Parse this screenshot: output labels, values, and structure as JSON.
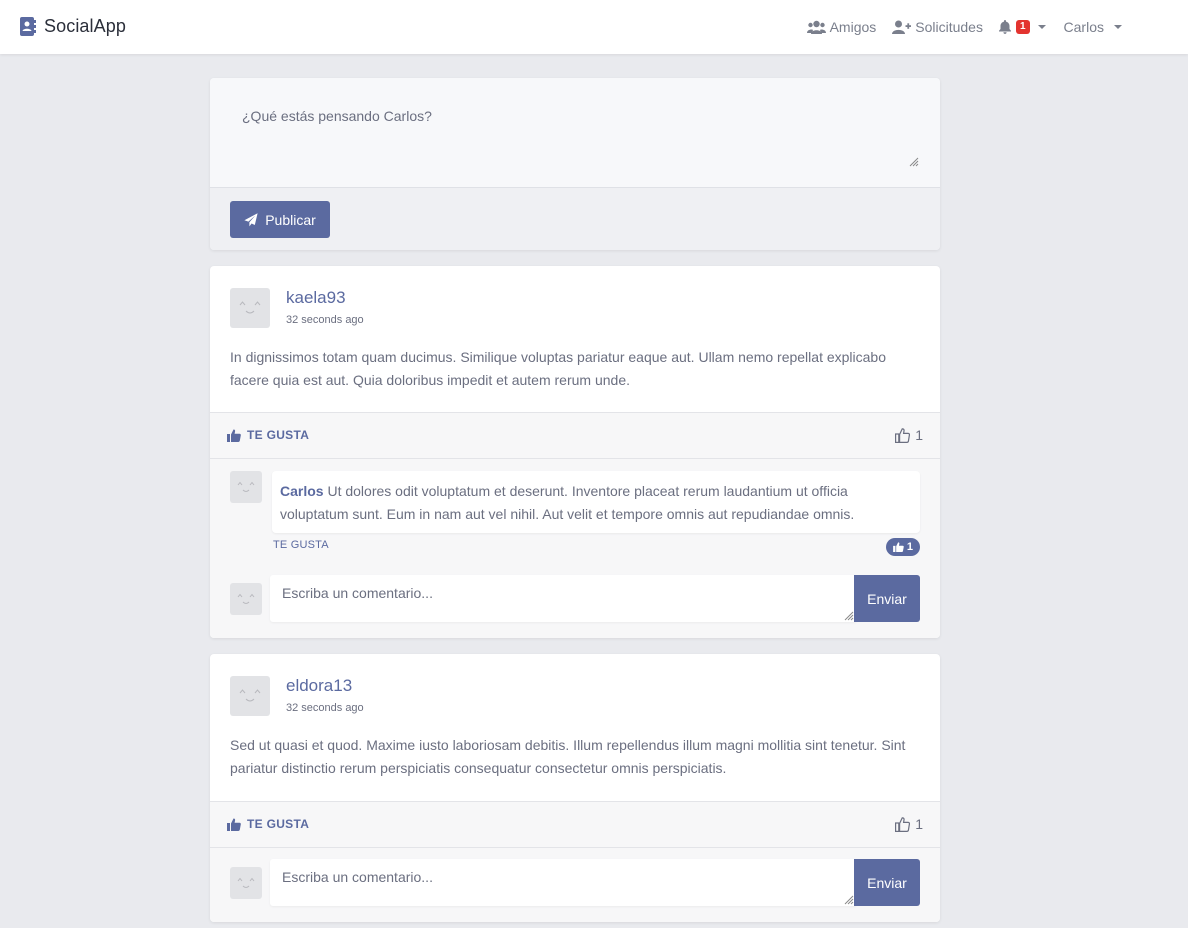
{
  "navbar": {
    "brand": "SocialApp",
    "friends_label": "Amigos",
    "requests_label": "Solicitudes",
    "notifications_count": "1",
    "user_name": "Carlos"
  },
  "composer": {
    "placeholder": "¿Qué estás pensando Carlos?",
    "submit_label": "Publicar"
  },
  "posts": [
    {
      "author": "kaela93",
      "time": "32 seconds ago",
      "body": "In dignissimos totam quam ducimus. Similique voluptas pariatur eaque aut. Ullam nemo repellat explicabo facere quia est aut. Quia doloribus impedit et autem rerum unde.",
      "like_label": "TE GUSTA",
      "like_count": "1",
      "comments": [
        {
          "author": "Carlos",
          "text": "Ut dolores odit voluptatum et deserunt. Inventore placeat rerum laudantium ut officia voluptatum sunt. Eum in nam aut vel nihil. Aut velit et tempore omnis aut repudiandae omnis.",
          "like_label": "TE GUSTA",
          "like_count": "1"
        }
      ],
      "comment_placeholder": "Escriba un comentario...",
      "send_label": "Enviar"
    },
    {
      "author": "eldora13",
      "time": "32 seconds ago",
      "body": "Sed ut quasi et quod. Maxime iusto laboriosam debitis. Illum repellendus illum magni mollitia sint tenetur. Sint pariatur distinctio rerum perspiciatis consequatur consectetur omnis perspiciatis.",
      "like_label": "TE GUSTA",
      "like_count": "1",
      "comments": [],
      "comment_placeholder": "Escriba un comentario...",
      "send_label": "Enviar"
    }
  ],
  "colors": {
    "primary": "#5b6aa0",
    "badge": "#e3342f",
    "background": "#e9eaee"
  }
}
